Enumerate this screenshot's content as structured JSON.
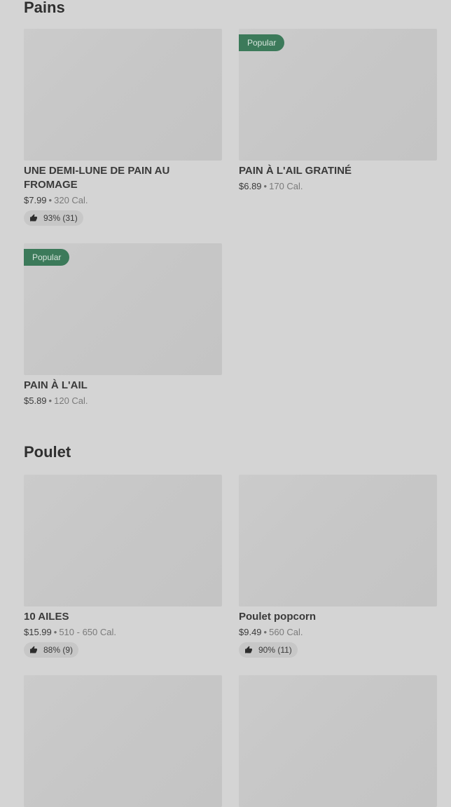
{
  "sections": [
    {
      "title": "Pains",
      "items": [
        {
          "badge": "",
          "name": "UNE DEMI-LUNE DE PAIN AU FROMAGE",
          "price": "$7.99",
          "calories": "320 Cal.",
          "rating": "93% (31)"
        },
        {
          "badge": "Popular",
          "name": "PAIN À L'AIL GRATINÉ",
          "price": "$6.89",
          "calories": "170 Cal.",
          "rating": ""
        },
        {
          "badge": "Popular",
          "name": "PAIN À L'AIL",
          "price": "$5.89",
          "calories": "120 Cal.",
          "rating": ""
        }
      ]
    },
    {
      "title": "Poulet",
      "items": [
        {
          "badge": "",
          "name": "10 AILES",
          "price": "$15.99",
          "calories": "510 - 650 Cal.",
          "rating": "88% (9)"
        },
        {
          "badge": "",
          "name": "Poulet popcorn",
          "price": "$9.49",
          "calories": "560 Cal.",
          "rating": "90% (11)"
        }
      ]
    }
  ],
  "separator": "•",
  "icons": {
    "rating": "thumbs-up-icon"
  },
  "colors": {
    "badge": "#3c7a5a",
    "background": "#d4d4d4"
  }
}
